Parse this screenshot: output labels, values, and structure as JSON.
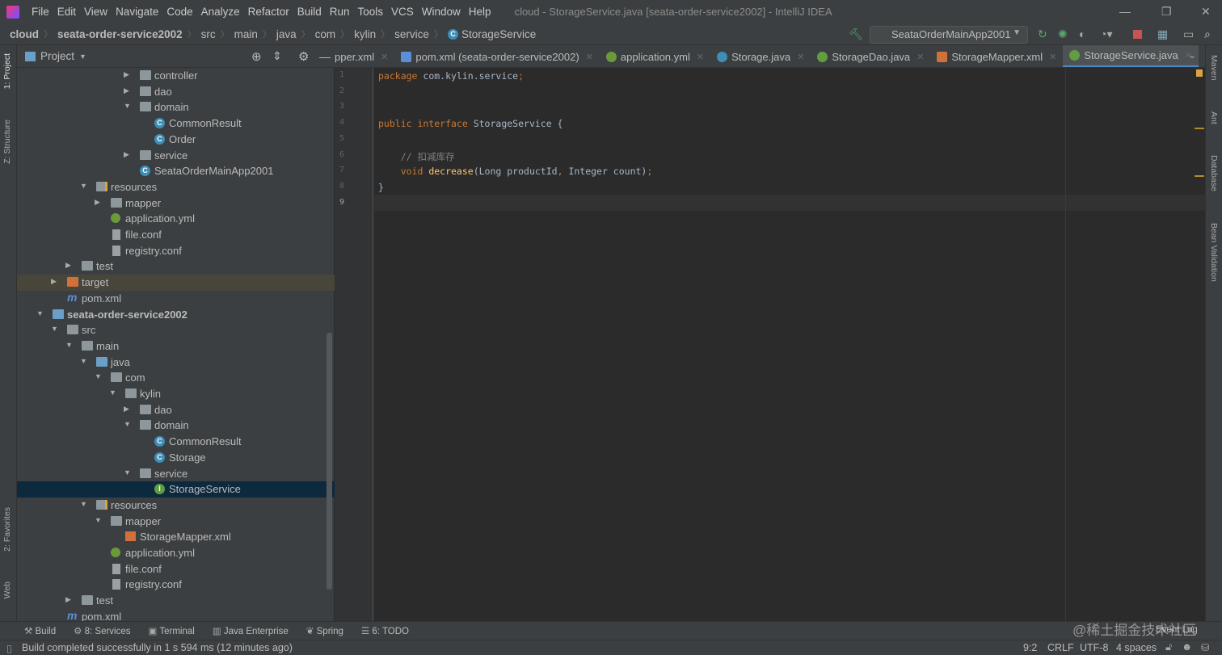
{
  "menu": [
    "File",
    "Edit",
    "View",
    "Navigate",
    "Code",
    "Analyze",
    "Refactor",
    "Build",
    "Run",
    "Tools",
    "VCS",
    "Window",
    "Help"
  ],
  "window_title": "cloud - StorageService.java [seata-order-service2002] - IntelliJ IDEA",
  "breadcrumb": [
    "cloud",
    "seata-order-service2002",
    "src",
    "main",
    "java",
    "com",
    "kylin",
    "service",
    "StorageService"
  ],
  "run_config": "SeataOrderMainApp2001",
  "left_tool_tabs": [
    "1: Project",
    "Z: Structure",
    "2: Favorites",
    "Web"
  ],
  "right_tool_tabs": [
    "Maven",
    "Ant",
    "Database",
    "Bean Validation"
  ],
  "project_panel": {
    "title": "Project"
  },
  "tree": [
    {
      "label": "controller",
      "level": 6,
      "type": "folder",
      "expanded": false
    },
    {
      "label": "dao",
      "level": 6,
      "type": "folder",
      "expanded": false
    },
    {
      "label": "domain",
      "level": 6,
      "type": "folder",
      "expanded": true
    },
    {
      "label": "CommonResult",
      "level": 7,
      "type": "class"
    },
    {
      "label": "Order",
      "level": 7,
      "type": "class"
    },
    {
      "label": "service",
      "level": 6,
      "type": "folder",
      "expanded": false
    },
    {
      "label": "SeataOrderMainApp2001",
      "level": 6,
      "type": "springclass"
    },
    {
      "label": "resources",
      "level": 3,
      "type": "resfolder",
      "expanded": true
    },
    {
      "label": "mapper",
      "level": 4,
      "type": "folder",
      "expanded": false
    },
    {
      "label": "application.yml",
      "level": 4,
      "type": "yml"
    },
    {
      "label": "file.conf",
      "level": 4,
      "type": "file"
    },
    {
      "label": "registry.conf",
      "level": 4,
      "type": "file"
    },
    {
      "label": "test",
      "level": 2,
      "type": "folder",
      "expanded": false
    },
    {
      "label": "target",
      "level": 1,
      "type": "orangefolder",
      "expanded": false,
      "highlight": true
    },
    {
      "label": "pom.xml",
      "level": 1,
      "type": "maven"
    },
    {
      "label": "seata-order-service2002",
      "level": 0,
      "type": "module",
      "expanded": true,
      "bold": true
    },
    {
      "label": "src",
      "level": 1,
      "type": "folder",
      "expanded": true
    },
    {
      "label": "main",
      "level": 2,
      "type": "folder",
      "expanded": true
    },
    {
      "label": "java",
      "level": 3,
      "type": "bluefolder",
      "expanded": true
    },
    {
      "label": "com",
      "level": 4,
      "type": "folder",
      "expanded": true
    },
    {
      "label": "kylin",
      "level": 5,
      "type": "folder",
      "expanded": true
    },
    {
      "label": "dao",
      "level": 6,
      "type": "folder",
      "expanded": false
    },
    {
      "label": "domain",
      "level": 6,
      "type": "folder",
      "expanded": true
    },
    {
      "label": "CommonResult",
      "level": 7,
      "type": "class"
    },
    {
      "label": "Storage",
      "level": 7,
      "type": "class"
    },
    {
      "label": "service",
      "level": 6,
      "type": "folder",
      "expanded": true
    },
    {
      "label": "StorageService",
      "level": 7,
      "type": "interface",
      "selected": true
    },
    {
      "label": "resources",
      "level": 3,
      "type": "resfolder",
      "expanded": true
    },
    {
      "label": "mapper",
      "level": 4,
      "type": "folder",
      "expanded": true
    },
    {
      "label": "StorageMapper.xml",
      "level": 5,
      "type": "xml"
    },
    {
      "label": "application.yml",
      "level": 4,
      "type": "yml"
    },
    {
      "label": "file.conf",
      "level": 4,
      "type": "file"
    },
    {
      "label": "registry.conf",
      "level": 4,
      "type": "file"
    },
    {
      "label": "test",
      "level": 2,
      "type": "folder",
      "expanded": false
    },
    {
      "label": "pom.xml",
      "level": 1,
      "type": "maven"
    }
  ],
  "tabs": [
    {
      "label": "pper.xml",
      "icon": "none"
    },
    {
      "label": "pom.xml (seata-order-service2002)",
      "icon": "maven"
    },
    {
      "label": "application.yml",
      "icon": "yml"
    },
    {
      "label": "Storage.java",
      "icon": "class"
    },
    {
      "label": "StorageDao.java",
      "icon": "interface"
    },
    {
      "label": "StorageMapper.xml",
      "icon": "xml"
    },
    {
      "label": "StorageService.java",
      "icon": "interface",
      "active": true
    }
  ],
  "code_lines": [
    [
      [
        "kw",
        "package "
      ],
      [
        "",
        "com.kylin.service"
      ],
      [
        "kw",
        ";"
      ]
    ],
    [],
    [],
    [
      [
        "kw",
        "public interface "
      ],
      [
        "",
        "StorageService {"
      ]
    ],
    [],
    [
      [
        "cm",
        "    // 扣减库存"
      ]
    ],
    [
      [
        "kw",
        "    void "
      ],
      [
        "fn",
        "decrease"
      ],
      [
        "",
        "(Long productId"
      ],
      [
        "kw",
        ","
      ],
      [
        "",
        " Integer count)"
      ],
      [
        "kw",
        ";"
      ]
    ],
    [
      [
        "",
        "}"
      ]
    ],
    []
  ],
  "bottom_tools": [
    "Build",
    "8: Services",
    "Terminal",
    "Java Enterprise",
    "Spring",
    "6: TODO"
  ],
  "status": {
    "message": "Build completed successfully in 1 s 594 ms (12 minutes ago)",
    "position": "9:2",
    "line_sep": "CRLF",
    "encoding": "UTF-8",
    "indent": "4 spaces",
    "event_log": "Event Log"
  },
  "watermark": "@稀土掘金技术社区"
}
